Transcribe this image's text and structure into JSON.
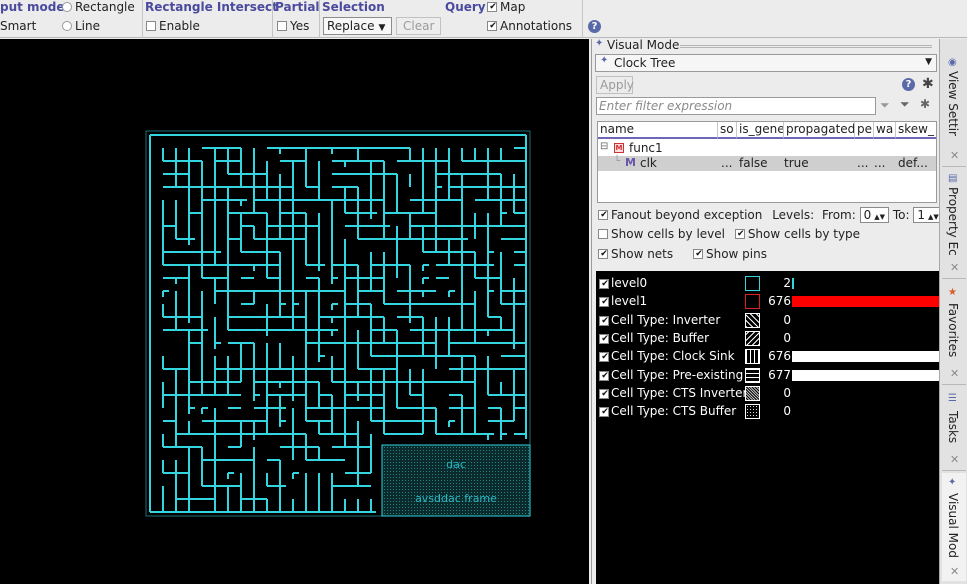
{
  "toolbar": {
    "input_mode": {
      "title": "put mode",
      "options": [
        "Rectangle",
        "Smart",
        "Line"
      ]
    },
    "rect_intersect": {
      "title": "Rectangle Intersect",
      "enable_label": "Enable"
    },
    "partial": {
      "title": "Partial",
      "yes_label": "Yes"
    },
    "selection": {
      "title": "Selection",
      "mode_value": "Replace",
      "clear_label": "Clear"
    },
    "query": {
      "title": "Query",
      "map_label": "Map",
      "annotations_label": "Annotations"
    },
    "help_glyph": "?"
  },
  "canvas": {
    "background": "#000000",
    "wire_color": "#33d6e0",
    "macro_labels": {
      "name": "dac",
      "frame": "avsddac.frame"
    }
  },
  "panel": {
    "title": "Visual Mode",
    "mode_value": "Clock Tree",
    "apply_label": "Apply",
    "filter_placeholder": "Enter filter expression",
    "tree": {
      "columns": [
        "name",
        "so",
        "is_gene",
        "propagated",
        "pe",
        "wa",
        "skew_"
      ],
      "rows": [
        {
          "name": "func1",
          "vals": [
            "",
            "",
            "",
            "",
            "",
            ""
          ]
        },
        {
          "name": "clk",
          "vals": [
            "...",
            "false",
            "true",
            "...",
            "...",
            "def..."
          ]
        }
      ]
    },
    "fanout_label": "Fanout beyond exception",
    "levels_label": "Levels:",
    "from_label": "From:",
    "from_value": "0",
    "to_label": "To:",
    "to_value": "1",
    "show_cells_by_level": "Show cells by level",
    "show_cells_by_type": "Show cells by type",
    "show_nets": "Show nets",
    "show_pins": "Show pins"
  },
  "legend": {
    "rows": [
      {
        "label": "level0",
        "count": "2",
        "swatch": "level0",
        "bar_color": "#33d6e0",
        "fraction": 0.003
      },
      {
        "label": "level1",
        "count": "676",
        "swatch": "level1",
        "bar_color": "#ff0000",
        "fraction": 0.999
      },
      {
        "label": "Cell Type: Inverter",
        "count": "0",
        "swatch": "inverter"
      },
      {
        "label": "Cell Type: Buffer",
        "count": "0",
        "swatch": "buffer"
      },
      {
        "label": "Cell Type: Clock Sink",
        "count": "676",
        "swatch": "sink",
        "bar_color": "#ffffff",
        "fraction": 0.999
      },
      {
        "label": "Cell Type: Pre-existing",
        "count": "677",
        "swatch": "preexisting",
        "bar_color": "#ffffff",
        "fraction": 1.0
      },
      {
        "label": "Cell Type: CTS Inverter",
        "count": "0",
        "swatch": "cts_inverter"
      },
      {
        "label": "Cell Type: CTS Buffer",
        "count": "0",
        "swatch": "cts_buffer"
      }
    ]
  },
  "side_tabs": [
    "View Settir",
    "Property Ec",
    "Favorites",
    "Tasks",
    "Visual Mod"
  ]
}
